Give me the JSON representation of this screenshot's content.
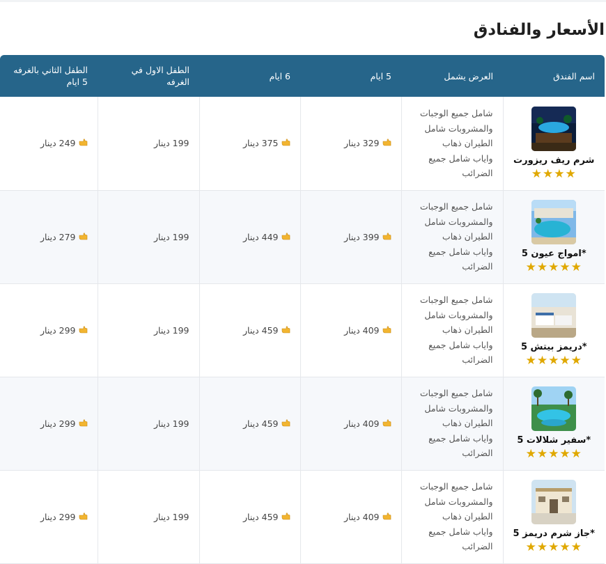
{
  "title": "الأسعار والفنادق",
  "colors": {
    "header_bg": "#26658a",
    "star": "#e0a800",
    "hand": "#f2b531"
  },
  "headers": {
    "hotel": "اسم الفندق",
    "offer": "العرض يشمل",
    "days5": "5 ايام",
    "days6": "6 ايام",
    "child1": "الطفل الاول في الغرفه",
    "child2": "الطفل الثاني بالغرفه 5 ايام"
  },
  "rows": [
    {
      "name": "شرم ريف ريزورت",
      "stars": "★★★★",
      "icon": "hotel-photo-icon",
      "offer": [
        "شامل جميع الوجبات",
        "والمشروبات شامل",
        "الطيران ذهاب",
        "واياب شامل جميع",
        "الضرائب"
      ],
      "price5": "329 دينار",
      "price6": "375 دينار",
      "child1": "199 دينار",
      "child2": "249 دينار"
    },
    {
      "name": "*امواج عيون 5",
      "stars": "★★★★★",
      "icon": "hotel-photo-icon",
      "offer": [
        "شامل جميع الوجبات",
        "والمشروبات شامل",
        "الطيران ذهاب",
        "واياب شامل جميع",
        "الضرائب"
      ],
      "price5": "399 دينار",
      "price6": "449 دينار",
      "child1": "199 دينار",
      "child2": "279 دينار"
    },
    {
      "name": "*دريمز بيتش 5",
      "stars": "★★★★★",
      "icon": "hotel-photo-icon",
      "offer": [
        "شامل جميع الوجبات",
        "والمشروبات شامل",
        "الطيران ذهاب",
        "واياب شامل جميع",
        "الضرائب"
      ],
      "price5": "409 دينار",
      "price6": "459 دينار",
      "child1": "199 دينار",
      "child2": "299 دينار"
    },
    {
      "name": "*سفير شلالات 5",
      "stars": "★★★★★",
      "icon": "hotel-photo-icon",
      "offer": [
        "شامل جميع الوجبات",
        "والمشروبات شامل",
        "الطيران ذهاب",
        "واياب شامل جميع",
        "الضرائب"
      ],
      "price5": "409 دينار",
      "price6": "459 دينار",
      "child1": "199 دينار",
      "child2": "299 دينار"
    },
    {
      "name": "*جاز شرم دريمز 5",
      "stars": "★★★★★",
      "icon": "hotel-photo-icon",
      "offer": [
        "شامل جميع الوجبات",
        "والمشروبات شامل",
        "الطيران ذهاب",
        "واياب شامل جميع",
        "الضرائب"
      ],
      "price5": "409 دينار",
      "price6": "459 دينار",
      "child1": "199 دينار",
      "child2": "299 دينار"
    }
  ]
}
